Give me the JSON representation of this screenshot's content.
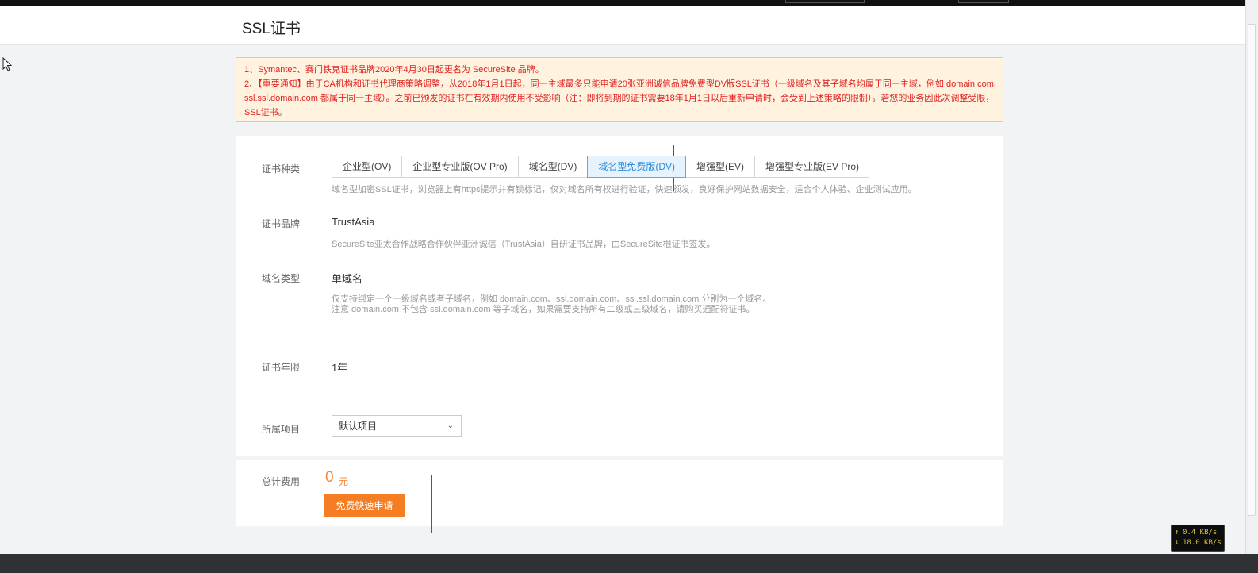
{
  "header": {
    "title": "SSL证书"
  },
  "notice": {
    "lines": [
      "1、Symantec、赛门铁克证书品牌2020年4月30日起更名为 SecureSite 品牌。",
      "2、【重要通知】由于CA机构和证书代理商策略调整，从2018年1月1日起，同一主域最多只能申请20张亚洲诚信品牌免费型DV版SSL证书（一级域名及其子域名均属于同一主域，例如 domain.com、ssl.domain.com、",
      "ssl.ssl.domain.com 都属于同一主域）。之前已颁发的证书在有效期内使用不受影响（注：即将到期的证书需要18年1月1日以后重新申请时，会受到上述策略的限制）。若您的业务因此次调整受限，建议您购买收费型",
      "SSL证书。"
    ]
  },
  "form": {
    "cert_type": {
      "label": "证书种类",
      "tabs": [
        {
          "label": "企业型(OV)",
          "active": false
        },
        {
          "label": "企业型专业版(OV Pro)",
          "active": false
        },
        {
          "label": "域名型(DV)",
          "active": false
        },
        {
          "label": "域名型免费版(DV)",
          "active": true
        },
        {
          "label": "增强型(EV)",
          "active": false
        },
        {
          "label": "增强型专业版(EV Pro)",
          "active": false
        }
      ],
      "desc": "域名型加密SSL证书，浏览器上有https提示并有锁标记，仅对域名所有权进行验证，快速颁发，良好保护网站数据安全，适合个人体验、企业测试应用。"
    },
    "brand": {
      "label": "证书品牌",
      "value": "TrustAsia",
      "desc": "SecureSite亚太合作战略合作伙伴亚洲诚信（TrustAsia）自研证书品牌，由SecureSite根证书签发。"
    },
    "domain_type": {
      "label": "域名类型",
      "value": "单域名",
      "desc1": "仅支持绑定一个一级域名或者子域名，例如 domain.com、ssl.domain.com、ssl.ssl.domain.com 分别为一个域名。",
      "desc2": "注意 domain.com 不包含 ssl.domain.com 等子域名，如果需要支持所有二级或三级域名，请购买通配符证书。"
    },
    "duration": {
      "label": "证书年限",
      "value": "1年"
    },
    "project": {
      "label": "所属项目",
      "selected": "默认项目"
    }
  },
  "checkout": {
    "total_label": "总计费用",
    "total_value": "0",
    "unit": "元",
    "apply_label": "免费快速申请"
  },
  "netmon": {
    "up": "0.4 KB/s",
    "down": "18.0 KB/s"
  },
  "colors": {
    "accent": "#f57d23",
    "active_tab": "#2a8ad8",
    "notice_text": "#e02020"
  }
}
